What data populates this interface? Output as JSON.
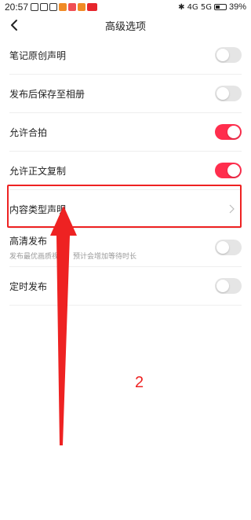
{
  "status_bar": {
    "time": "20:57",
    "network": "4G 5G",
    "battery_percent": "39%"
  },
  "header": {
    "title": "高级选项",
    "back_icon": "chevron-left-icon"
  },
  "settings": [
    {
      "label": "笔记原创声明",
      "type": "toggle",
      "enabled": false
    },
    {
      "label": "发布后保存至相册",
      "type": "toggle",
      "enabled": false
    },
    {
      "label": "允许合拍",
      "type": "toggle",
      "enabled": true
    },
    {
      "label": "允许正文复制",
      "type": "toggle",
      "enabled": true
    },
    {
      "label": "内容类型声明",
      "type": "link"
    },
    {
      "label": "高清发布",
      "sublabel": "发布最优画质视频，预计会增加等待时长",
      "type": "toggle",
      "enabled": false
    },
    {
      "label": "定时发布",
      "type": "toggle",
      "enabled": false
    }
  ],
  "annotation": {
    "step_number": "2",
    "color": "#ee2222"
  },
  "colors": {
    "toggle_on": "#ff2e4d",
    "toggle_off": "#e5e5e5"
  }
}
